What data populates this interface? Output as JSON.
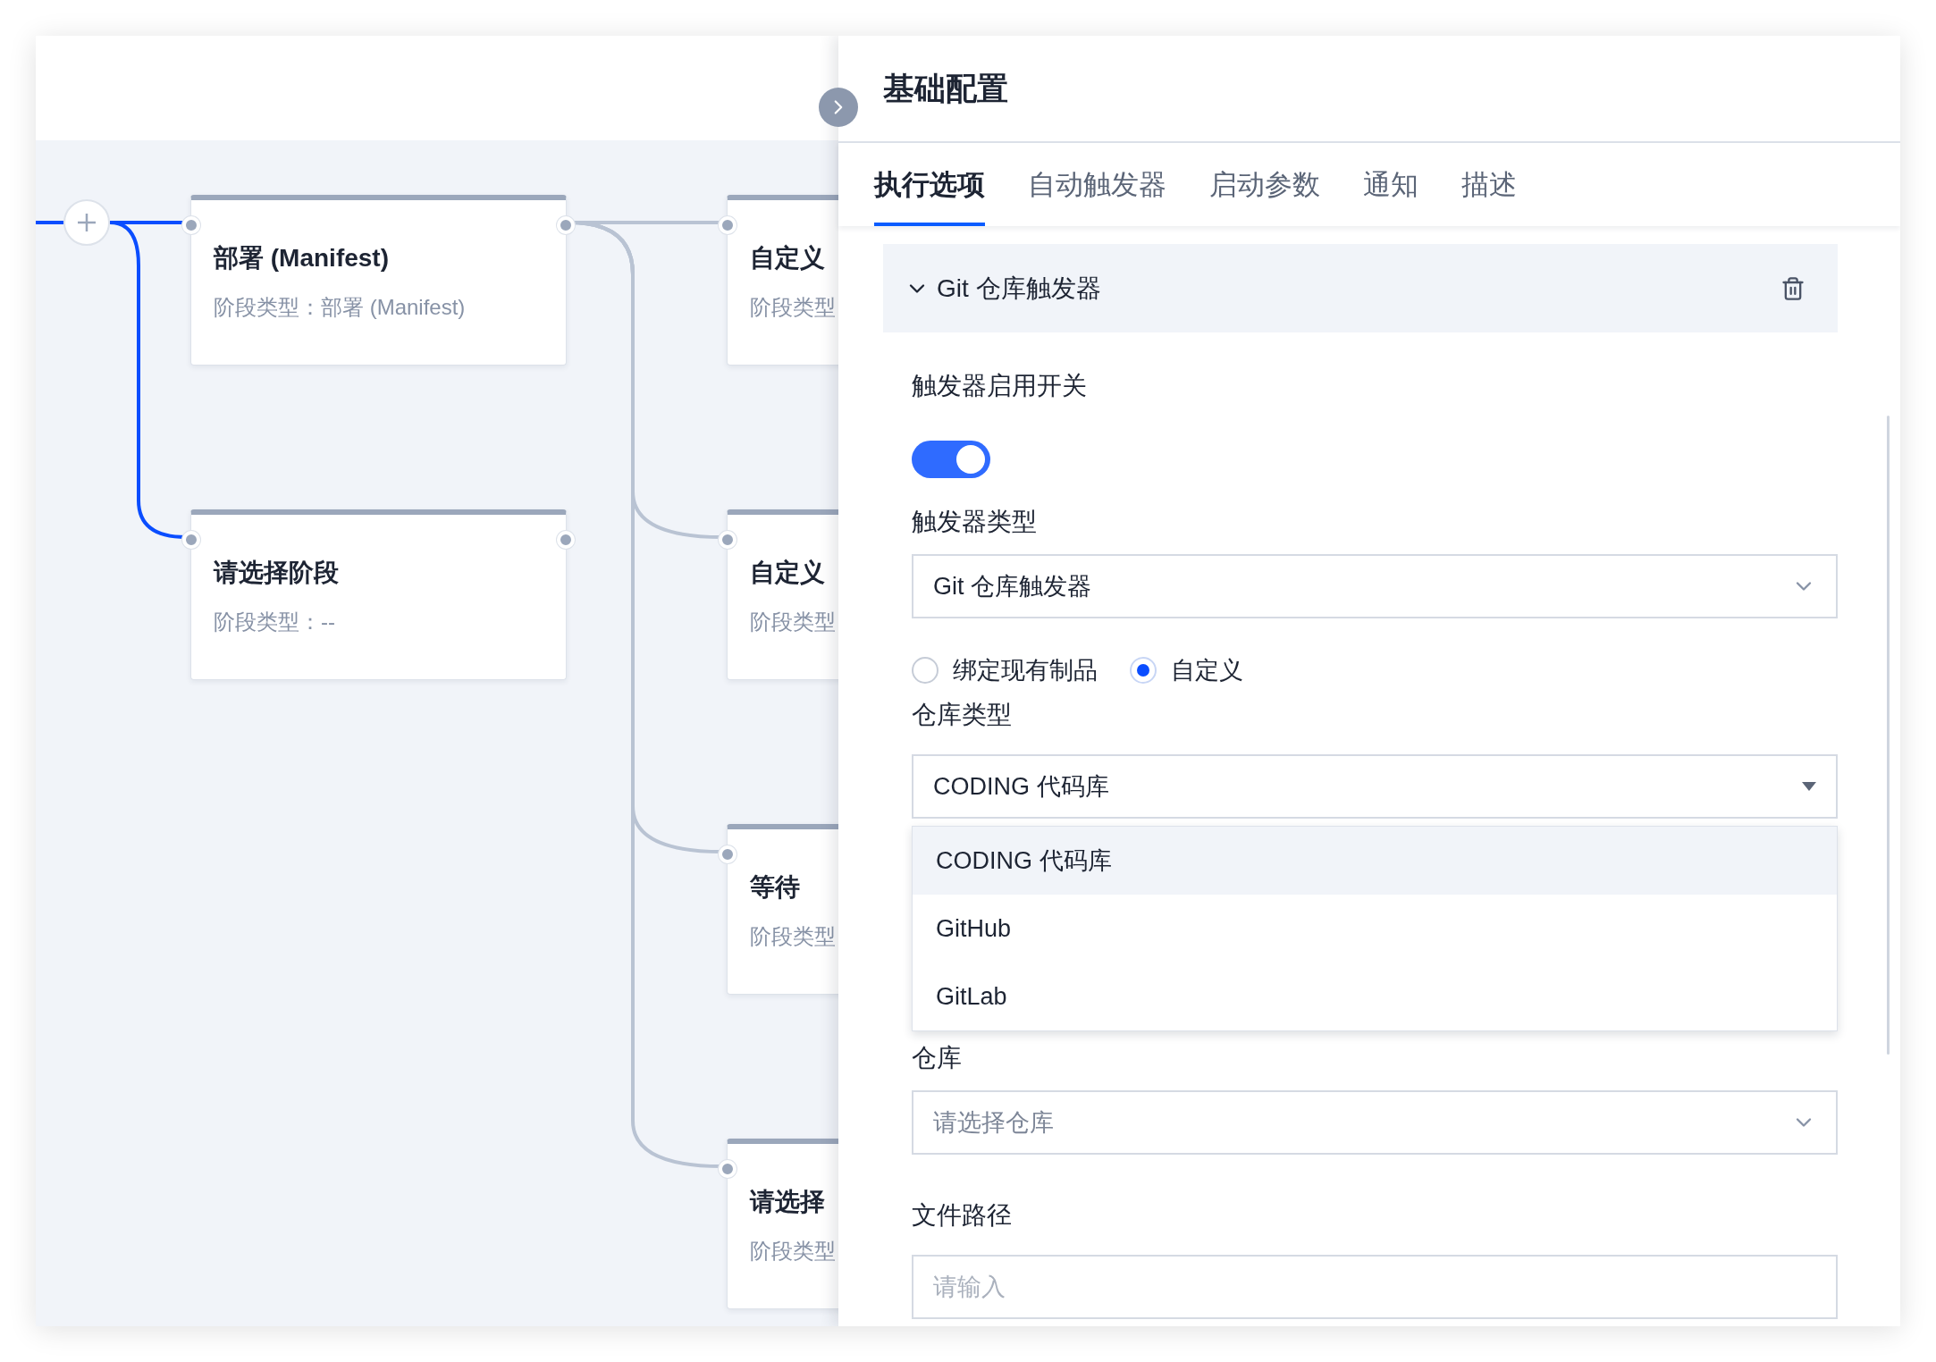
{
  "canvas": {
    "columns": [
      [
        {
          "title": "部署 (Manifest)",
          "subtitle": "阶段类型：部署 (Manifest)"
        },
        {
          "title": "请选择阶段",
          "subtitle": "阶段类型：--"
        }
      ],
      [
        {
          "title": "自定义",
          "subtitle": "阶段类型"
        },
        {
          "title": "自定义",
          "subtitle": "阶段类型"
        },
        {
          "title": "等待",
          "subtitle": "阶段类型"
        },
        {
          "title": "请选择",
          "subtitle": "阶段类型"
        }
      ]
    ]
  },
  "panel": {
    "title": "基础配置",
    "tabs": [
      {
        "label": "执行选项",
        "selected": true
      },
      {
        "label": "自动触发器",
        "selected": false
      },
      {
        "label": "启动参数",
        "selected": false
      },
      {
        "label": "通知",
        "selected": false
      },
      {
        "label": "描述",
        "selected": false
      }
    ],
    "section": {
      "title": "Git 仓库触发器",
      "expanded": true
    },
    "fields": [
      {
        "kind": "toggle",
        "label": "触发器启用开关",
        "on": true
      },
      {
        "kind": "select",
        "label": "触发器类型",
        "value": "Git 仓库触发器"
      },
      {
        "kind": "radio",
        "options": [
          {
            "label": "绑定现有制品",
            "selected": false
          },
          {
            "label": "自定义",
            "selected": true
          }
        ]
      },
      {
        "kind": "select",
        "label": "仓库类型",
        "value": "CODING 代码库",
        "options": [
          {
            "label": "CODING 代码库",
            "selected": true
          },
          {
            "label": "GitHub",
            "selected": false
          },
          {
            "label": "GitLab",
            "selected": false
          }
        ]
      },
      {
        "kind": "select",
        "label": "仓库",
        "placeholder": "请选择仓库"
      },
      {
        "kind": "input",
        "label": "文件路径",
        "placeholder": "请输入"
      }
    ]
  }
}
